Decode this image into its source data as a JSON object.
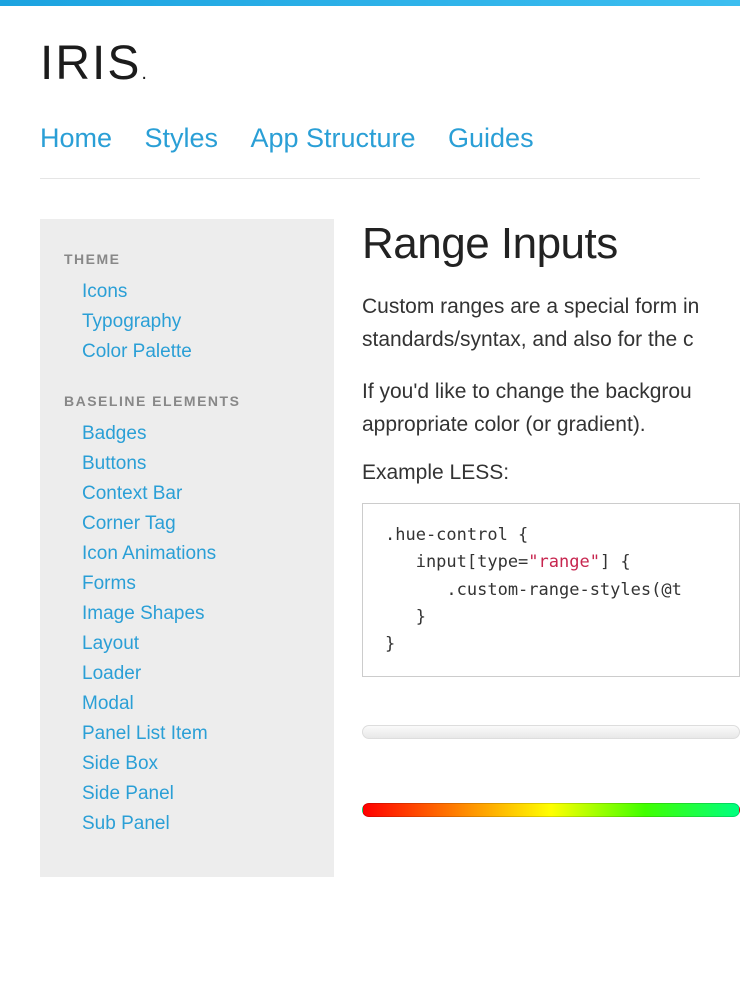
{
  "logo_text": "IRIS",
  "nav": [
    {
      "label": "Home"
    },
    {
      "label": "Styles"
    },
    {
      "label": "App Structure"
    },
    {
      "label": "Guides"
    }
  ],
  "sidebar": {
    "groups": [
      {
        "heading": "THEME",
        "items": [
          "Icons",
          "Typography",
          "Color Palette"
        ]
      },
      {
        "heading": "BASELINE ELEMENTS",
        "items": [
          "Badges",
          "Buttons",
          "Context Bar",
          "Corner Tag",
          "Icon Animations",
          "Forms",
          "Image Shapes",
          "Layout",
          "Loader",
          "Modal",
          "Panel List Item",
          "Side Box",
          "Side Panel",
          "Sub Panel"
        ]
      }
    ]
  },
  "main": {
    "title": "Range Inputs",
    "para1_line1": "Custom ranges are a special form in",
    "para1_line2": "standards/syntax, and also for the c",
    "para2_line1": "If you'd like to change the backgrou",
    "para2_line2": "appropriate color (or gradient).",
    "example_label": "Example LESS:",
    "code_l1": ".hue-control {",
    "code_l2": "   input[type=",
    "code_l2_str": "\"range\"",
    "code_l2_b": "] {",
    "code_l3": "      .custom-range-styles(@t",
    "code_l4": "   }",
    "code_l5": "}"
  }
}
